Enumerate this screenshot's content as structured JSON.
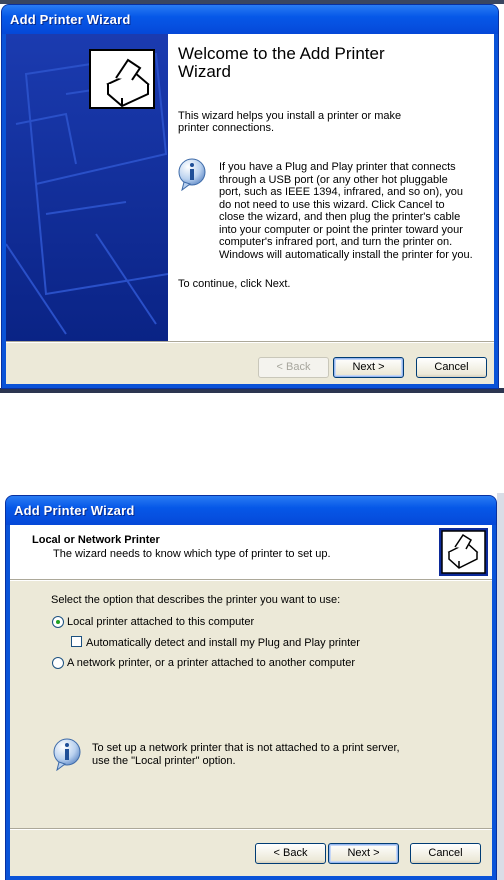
{
  "wizard1": {
    "title": "Add Printer Wizard",
    "heading": "Welcome to the Add Printer Wizard",
    "intro": "This wizard helps you install a printer or make printer connections.",
    "info_lines": [
      "If you have a Plug and Play printer that connects",
      "through a USB port (or any other hot pluggable",
      "port, such as IEEE 1394, infrared, and so on), you",
      "do not need to use this wizard. Click Cancel to",
      "close the wizard, and then plug the printer's cable",
      "into your computer or point the printer toward your",
      "computer's infrared port, and turn the printer on.",
      "Windows will automatically install the printer for you."
    ],
    "continue": "To continue, click Next.",
    "buttons": {
      "back": "< Back",
      "next": "Next >",
      "cancel": "Cancel"
    }
  },
  "wizard2": {
    "title": "Add Printer Wizard",
    "header_title": "Local or Network Printer",
    "header_subtitle": "The wizard needs to know which type of printer to set up.",
    "prompt": "Select the option that describes the printer you want to use:",
    "options": {
      "local": "Local printer attached to this computer",
      "auto_detect": "Automatically detect and install my Plug and Play printer",
      "network": "A network printer, or a printer attached to another computer"
    },
    "selected_option": "local",
    "auto_detect_checked": false,
    "info_lines": [
      "To set up a network printer that is not attached to a print server,",
      "use the \"Local printer\" option."
    ],
    "buttons": {
      "back": "< Back",
      "next": "Next >",
      "cancel": "Cancel"
    }
  },
  "colors": {
    "titlebar": "#0658e8",
    "dialog_face": "#ece9d8",
    "side_panel": "#0c2a9a",
    "radio_dot": "#21a121"
  }
}
